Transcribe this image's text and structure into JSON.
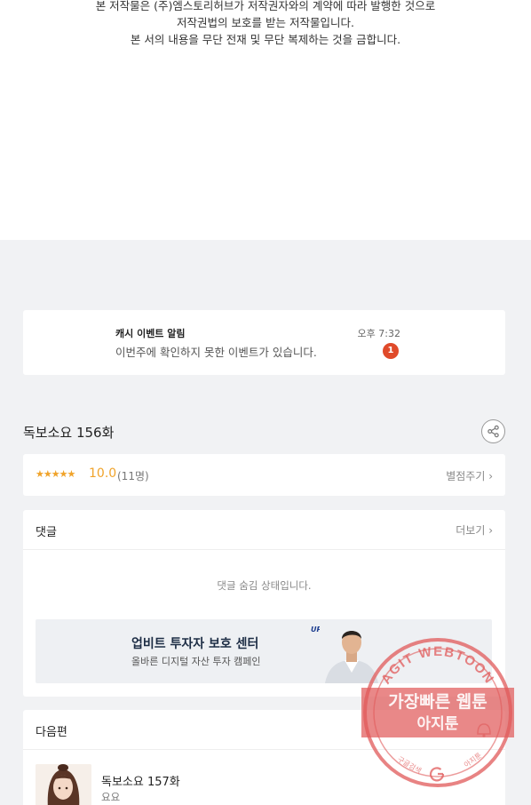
{
  "copyright": {
    "line1": "본 저작물은 (주)엠스토리허브가 저작권자와의 계약에 따라 발행한 것으로",
    "line2": "저작권법의 보호를 받는 저작물입니다.",
    "line3": "본 서의 내용을 무단 전재 및 무단 복제하는 것을 금합니다."
  },
  "notice": {
    "title": "캐시 이벤트 알림",
    "time": "오후 7:32",
    "message": "이번주에 확인하지 못한 이벤트가 있습니다.",
    "badge": "1"
  },
  "episode": {
    "title": "독보소요 156화"
  },
  "rating": {
    "stars": "★★★★★",
    "score": "10.0",
    "count": "(11명)",
    "rate_label": "별점주기 ›"
  },
  "comments": {
    "label": "댓글",
    "more": "더보기 ›",
    "hidden_text": "댓글 숨김 상태입니다."
  },
  "ad": {
    "logo": "UPbit",
    "title": "업비트 투자자 보호 센터",
    "subtitle": "올바른 디지털 자산 투자 캠페인"
  },
  "next": {
    "label": "다음편",
    "title": "독보소요 157화",
    "subtitle": "요요"
  },
  "stamp": {
    "top_text": "AGIT WEBTOON",
    "main_line1": "가장빠른 웹툰",
    "main_line2": "아지툰",
    "bottom_left": "구글검색",
    "bottom_right": "아지툰"
  },
  "colors": {
    "accent_star": "#f0a32a",
    "badge": "#e04a2a",
    "stamp": "#e05a5a",
    "background": "#f1f2f4"
  }
}
